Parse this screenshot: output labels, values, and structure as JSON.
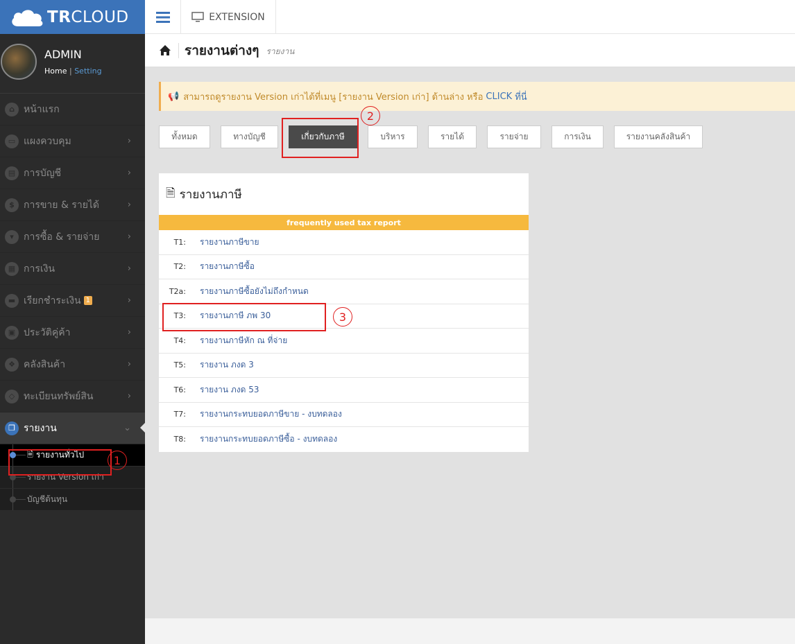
{
  "brand": {
    "bold": "TR",
    "light": "CLOUD"
  },
  "topbar": {
    "extension_label": "EXTENSION"
  },
  "profile": {
    "name": "ADMIN",
    "home": "Home",
    "divider": "|",
    "setting": "Setting"
  },
  "sidebar": {
    "items": [
      {
        "label": "หน้าแรก",
        "icon": "home-icon",
        "has_chevron": false
      },
      {
        "label": "แผงควบคุม",
        "icon": "monitor-icon",
        "has_chevron": true
      },
      {
        "label": "การบัญชี",
        "icon": "book-icon",
        "has_chevron": true
      },
      {
        "label": "การขาย & รายได้",
        "icon": "dollar-icon",
        "has_chevron": true
      },
      {
        "label": "การซื้อ & รายจ่าย",
        "icon": "cart-icon",
        "has_chevron": true
      },
      {
        "label": "การเงิน",
        "icon": "calendar-icon",
        "has_chevron": true
      },
      {
        "label": "เรียกชำระเงิน",
        "icon": "card-icon",
        "has_chevron": true,
        "badge": "1"
      },
      {
        "label": "ประวัติคู่ค้า",
        "icon": "contact-icon",
        "has_chevron": true
      },
      {
        "label": "คลังสินค้า",
        "icon": "cubes-icon",
        "has_chevron": true
      },
      {
        "label": "ทะเบียนทรัพย์สิน",
        "icon": "diamond-icon",
        "has_chevron": true
      },
      {
        "label": "รายงาน",
        "icon": "report-icon",
        "has_chevron": true,
        "active": true
      }
    ],
    "sub_items": [
      {
        "label": "รายงานทั่วไป",
        "active": true
      },
      {
        "label": "รายงาน Version เก่า",
        "active": false
      },
      {
        "label": "บัญชีต้นทุน",
        "active": false
      }
    ]
  },
  "header": {
    "title": "รายงานต่างๆ",
    "subtitle": "รายงาน"
  },
  "alert": {
    "prefix": "สามารถดูรายงาน Version เก่าได้ที่เมนู [รายงาน Version เก่า] ด้านล่าง หรือ",
    "link": "CLICK",
    "suffix": "ที่นี่"
  },
  "tabs": [
    {
      "label": "ทั้งหมด",
      "active": false
    },
    {
      "label": "ทางบัญชี",
      "active": false
    },
    {
      "label": "เกี่ยวกับภาษี",
      "active": true
    },
    {
      "label": "บริหาร",
      "active": false
    },
    {
      "label": "รายได้",
      "active": false
    },
    {
      "label": "รายจ่าย",
      "active": false
    },
    {
      "label": "การเงิน",
      "active": false
    },
    {
      "label": "รายงานคลังสินค้า",
      "active": false
    }
  ],
  "panel": {
    "title": "รายงานภาษี",
    "frequent_label": "frequently used tax report",
    "reports": [
      {
        "code": "T1:",
        "name": "รายงานภาษีขาย"
      },
      {
        "code": "T2:",
        "name": "รายงานภาษีซื้อ"
      },
      {
        "code": "T2a:",
        "name": "รายงานภาษีซื้อยังไม่ถึงกำหนด"
      },
      {
        "code": "T3:",
        "name": "รายงานภาษี ภพ 30"
      },
      {
        "code": "T4:",
        "name": "รายงานภาษีหัก ณ ที่จ่าย"
      },
      {
        "code": "T5:",
        "name": "รายงาน ภงด 3"
      },
      {
        "code": "T6:",
        "name": "รายงาน ภงด 53"
      },
      {
        "code": "T7:",
        "name": "รายงานกระทบยอดภาษีขาย - งบทดลอง"
      },
      {
        "code": "T8:",
        "name": "รายงานกระทบยอดภาษีซื้อ - งบทดลอง"
      }
    ]
  },
  "annotations": {
    "step1": "1",
    "step2": "2",
    "step3": "3"
  },
  "colors": {
    "brand": "#3b73b9",
    "sidebar": "#2b2b2b",
    "accent_orange": "#f6b93e",
    "annotation_red": "#e02020"
  }
}
